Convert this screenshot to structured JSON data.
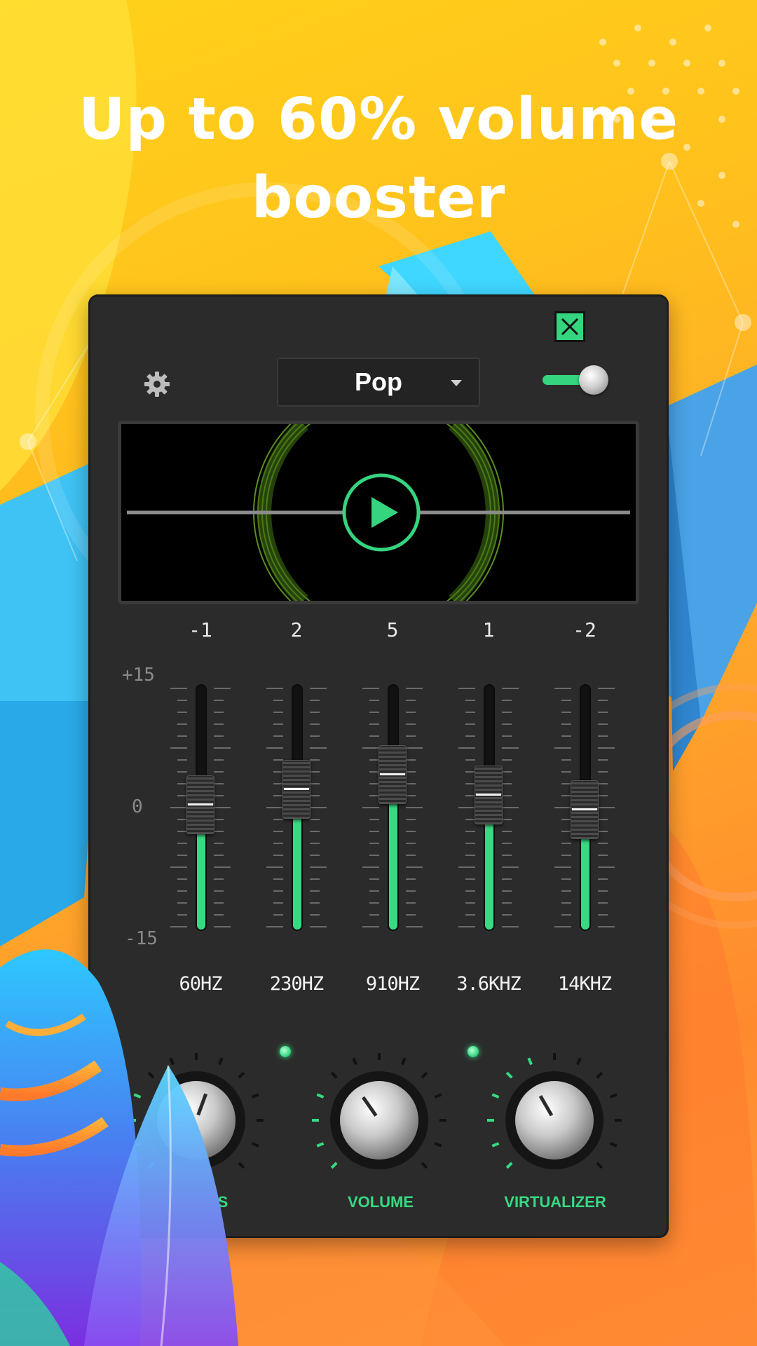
{
  "promo": {
    "headline_line1": "Up to 60% volume",
    "headline_line2": "booster"
  },
  "equalizer": {
    "preset": "Pop",
    "enabled": true,
    "scale": {
      "max": "+15",
      "mid": "0",
      "min": "-15"
    },
    "bands": [
      {
        "freq": "60HZ",
        "value": "-1",
        "level": -1
      },
      {
        "freq": "230HZ",
        "value": "2",
        "level": 2
      },
      {
        "freq": "910HZ",
        "value": "5",
        "level": 5
      },
      {
        "freq": "3.6KHZ",
        "value": "1",
        "level": 1
      },
      {
        "freq": "14KHZ",
        "value": "-2",
        "level": -2
      }
    ]
  },
  "knobs": {
    "bass_label": "S",
    "volume_label": "VOLUME",
    "virtualizer_label": "VIRTUALIZER"
  },
  "colors": {
    "accent": "#37d982",
    "panel": "#2b2b2b"
  },
  "icons": [
    "close-icon",
    "gear-icon",
    "caret-down-icon",
    "play-icon"
  ]
}
